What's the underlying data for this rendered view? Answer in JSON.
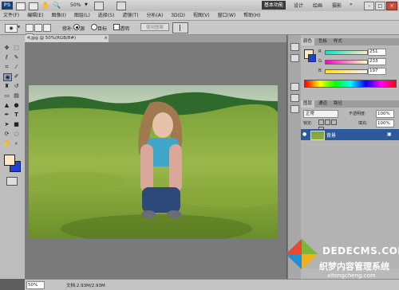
{
  "app": {
    "logo": "PS",
    "zoom": "50%",
    "workspace_button": "基本功能",
    "workspaces": [
      "设计",
      "绘画",
      "摄影"
    ]
  },
  "menu": [
    "文件(F)",
    "编辑(E)",
    "图像(I)",
    "图层(L)",
    "选择(S)",
    "滤镜(T)",
    "分析(A)",
    "3D(D)",
    "视图(V)",
    "窗口(W)",
    "帮助(H)"
  ],
  "options": {
    "feather_label": "修补:",
    "source_label": "源",
    "target_label": "目标",
    "transparent_label": "透明",
    "use_pattern_button": "使用图案"
  },
  "document": {
    "tab_title": "4.jpg @ 50%(RGB/8#)"
  },
  "color_panel": {
    "tabs": [
      "颜色",
      "色板",
      "样式"
    ],
    "labels": [
      "R",
      "G",
      "B"
    ],
    "values": [
      "251",
      "233",
      "197"
    ],
    "foreground": "#fbe9c5"
  },
  "layers_panel": {
    "tabs": [
      "图层",
      "通道",
      "路径"
    ],
    "blend_mode": "正常",
    "opacity_label": "不透明度:",
    "opacity": "100%",
    "lock_label": "锁定:",
    "fill_label": "填充:",
    "fill": "100%",
    "layer_name": "背景"
  },
  "status": {
    "zoom": "50%",
    "doc_info": "文档:2.93M/2.93M"
  },
  "watermark": {
    "site": "DEDECMS.COM",
    "caption": "织梦内容管理系统",
    "url": "xitongcheng.com"
  }
}
